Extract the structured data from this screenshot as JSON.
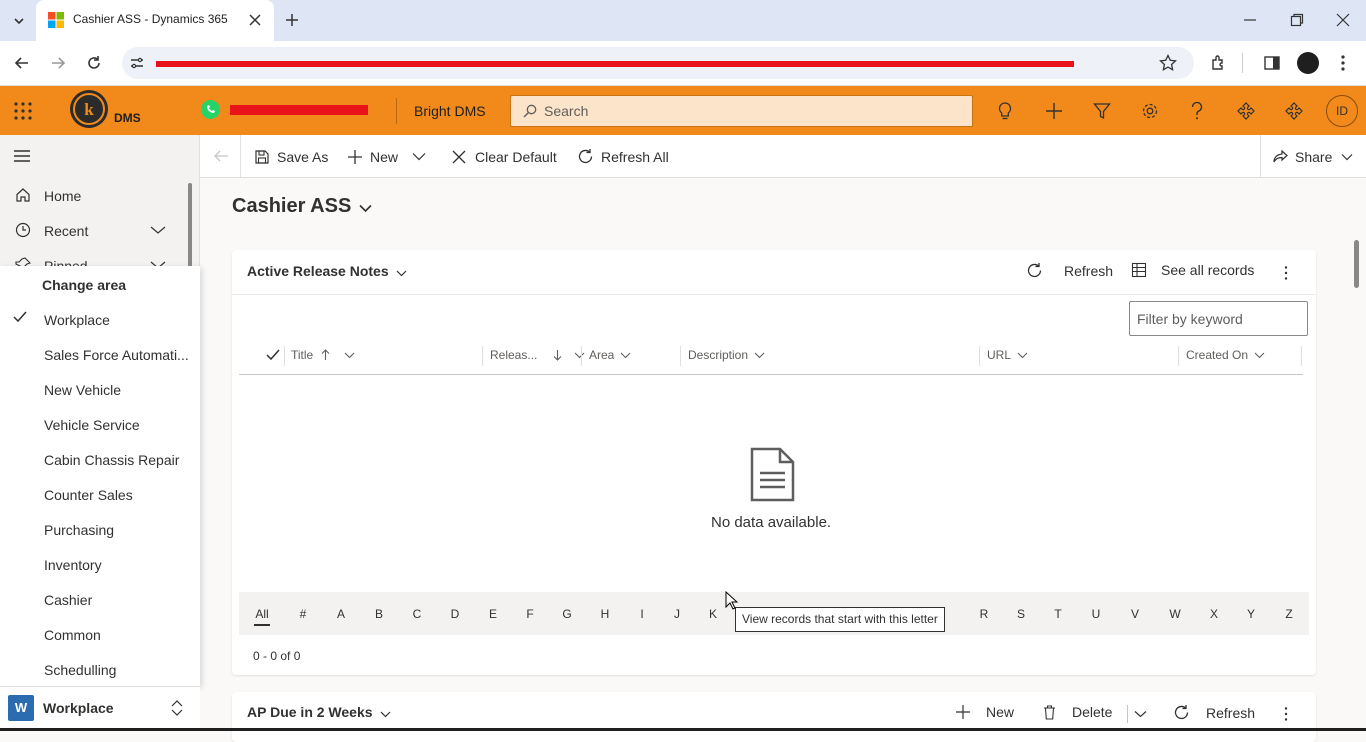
{
  "browser": {
    "tab_title": "Cashier ASS - Dynamics 365"
  },
  "app": {
    "env_name": "Bright DMS",
    "logo_text": "DMS",
    "search_placeholder": "Search",
    "user_initials": "ID",
    "accent": "#f18a1b"
  },
  "nav": {
    "home": "Home",
    "recent": "Recent",
    "pinned": "Pinned"
  },
  "area_menu": {
    "header": "Change area",
    "items": [
      "Workplace",
      "Sales Force Automati...",
      "New Vehicle",
      "Vehicle Service",
      "Cabin Chassis Repair",
      "Counter Sales",
      "Purchasing",
      "Inventory",
      "Cashier",
      "Common",
      "Schedulling"
    ],
    "selected": "Workplace",
    "switcher_label": "Workplace",
    "switcher_badge": "W"
  },
  "commands": {
    "save_as": "Save As",
    "new": "New",
    "clear_default": "Clear Default",
    "refresh_all": "Refresh All",
    "share": "Share"
  },
  "dashboard": {
    "title": "Cashier ASS"
  },
  "grid1": {
    "title": "Active Release Notes",
    "refresh": "Refresh",
    "see_all": "See all records",
    "filter_placeholder": "Filter by keyword",
    "columns": [
      "Title",
      "Releas...",
      "Area",
      "Description",
      "URL",
      "Created On"
    ],
    "empty_text": "No data available.",
    "letters": [
      "All",
      "#",
      "A",
      "B",
      "C",
      "D",
      "E",
      "F",
      "G",
      "H",
      "I",
      "J",
      "K",
      "R",
      "S",
      "T",
      "U",
      "V",
      "W",
      "X",
      "Y",
      "Z"
    ],
    "tooltip": "View records that start with this letter",
    "count": "0 - 0 of 0"
  },
  "grid2": {
    "title": "AP Due in 2 Weeks",
    "new": "New",
    "delete": "Delete",
    "refresh": "Refresh"
  }
}
